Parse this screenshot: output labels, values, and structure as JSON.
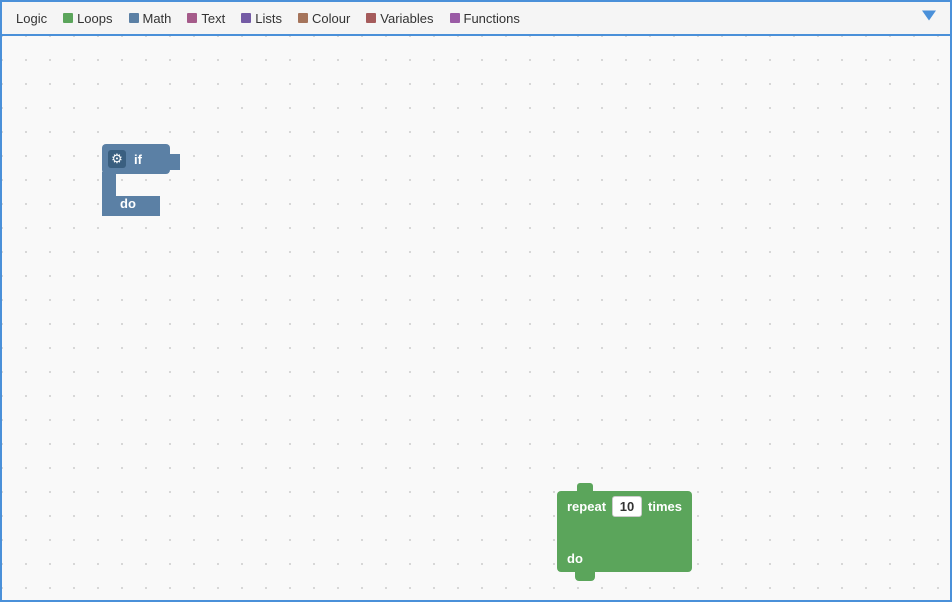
{
  "toolbar": {
    "items": [
      {
        "id": "logic",
        "label": "Logic",
        "color": "#4a90d9",
        "showDot": false
      },
      {
        "id": "loops",
        "label": "Loops",
        "color": "#5ba55b",
        "showDot": true
      },
      {
        "id": "math",
        "label": "Math",
        "color": "#5b80a5",
        "showDot": true
      },
      {
        "id": "text",
        "label": "Text",
        "color": "#a55b8a",
        "showDot": true
      },
      {
        "id": "lists",
        "label": "Lists",
        "color": "#745ba5",
        "showDot": true
      },
      {
        "id": "colour",
        "label": "Colour",
        "color": "#a5745b",
        "showDot": true
      },
      {
        "id": "variables",
        "label": "Variables",
        "color": "#a55b5b",
        "showDot": true
      },
      {
        "id": "functions",
        "label": "Functions",
        "color": "#9a5ba5",
        "showDot": true
      }
    ],
    "arrow_label": "▼"
  },
  "if_block": {
    "if_label": "if",
    "do_label": "do",
    "gear_icon": "⚙"
  },
  "repeat_block": {
    "repeat_label": "repeat",
    "times_label": "times",
    "do_label": "do",
    "count_value": "10"
  }
}
